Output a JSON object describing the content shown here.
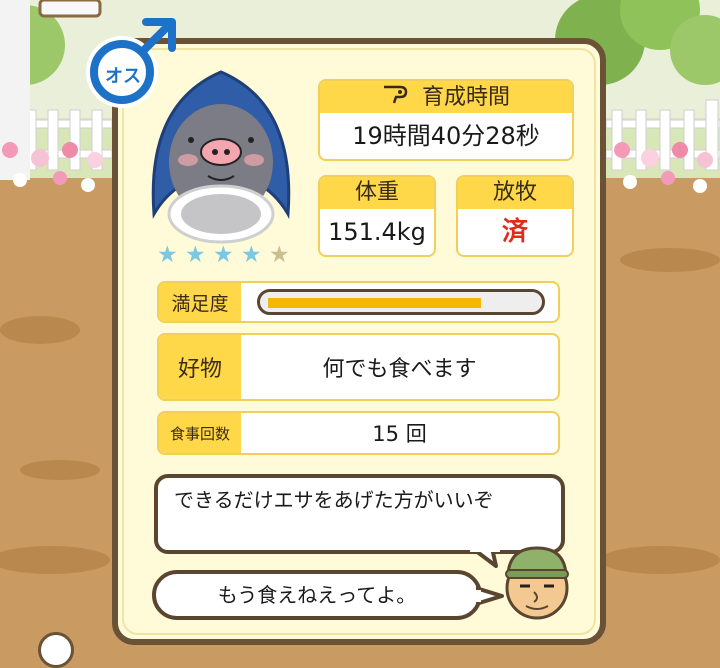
{
  "gender_badge": {
    "label": "オス",
    "color": "#1d72c8"
  },
  "rating": {
    "filled": 4,
    "total": 5,
    "filled_color": "#7cc8e2",
    "empty_color": "#c9bf8f"
  },
  "raise_time": {
    "label": "育成時間",
    "icon": "whistle-icon",
    "value": "19時間40分28秒"
  },
  "weight": {
    "label": "体重",
    "value": "151.4kg"
  },
  "grazing": {
    "label": "放牧",
    "value": "済",
    "value_color": "#e02a1c"
  },
  "satisfaction": {
    "label": "満足度",
    "level_percent": 80
  },
  "favorite_food": {
    "label": "好物",
    "value": "何でも食べます"
  },
  "meal_count": {
    "label": "食事回数",
    "value": "15 回"
  },
  "speech": {
    "farmer_line": "できるだけエサをあげた方がいいぞ",
    "pig_line": "もう食えねえってよ。"
  },
  "colors": {
    "card_border": "#6a5236",
    "card_bg": "#fffbd9",
    "header_yellow": "#ffd84a"
  }
}
